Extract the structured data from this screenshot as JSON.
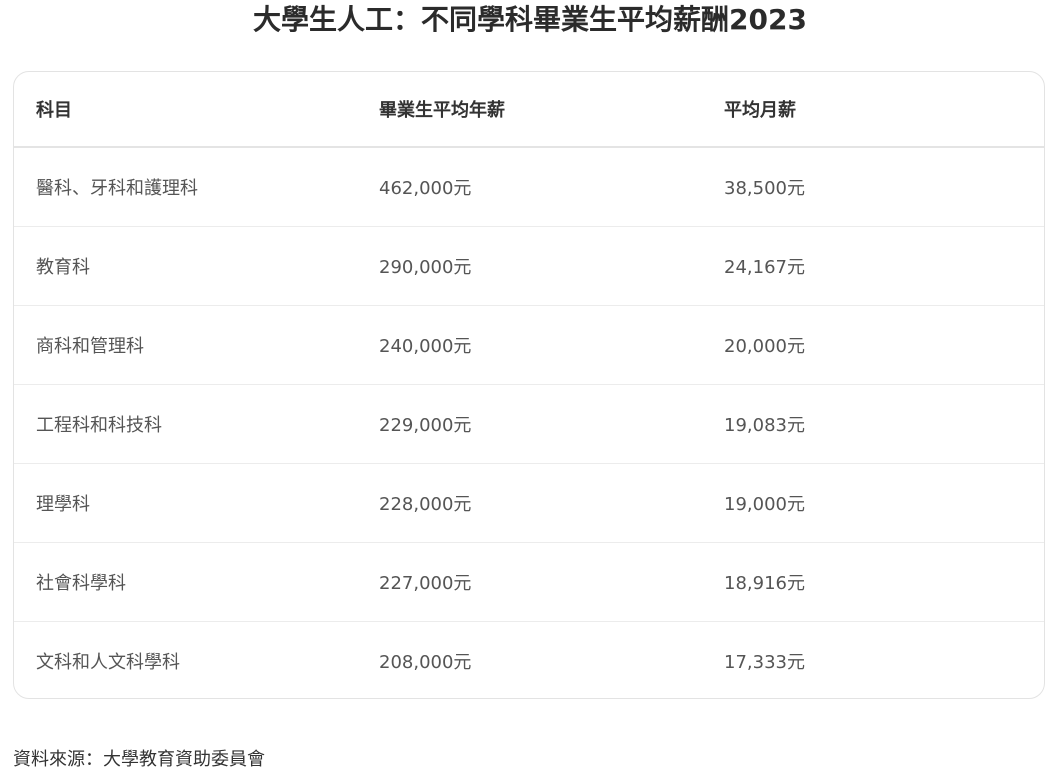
{
  "title": "大學生人工：不同學科畢業生平均薪酬2023",
  "table": {
    "headers": [
      "科目",
      "畢業生平均年薪",
      "平均月薪"
    ],
    "rows": [
      [
        "醫科、牙科和護理科",
        "462,000元",
        "38,500元"
      ],
      [
        "教育科",
        "290,000元",
        "24,167元"
      ],
      [
        "商科和管理科",
        "240,000元",
        "20,000元"
      ],
      [
        "工程科和科技科",
        "229,000元",
        "19,083元"
      ],
      [
        "理學科",
        "228,000元",
        "19,000元"
      ],
      [
        "社會科學科",
        "227,000元",
        "18,916元"
      ],
      [
        "文科和人文科學科",
        "208,000元",
        "17,333元"
      ]
    ]
  },
  "source": "資料來源：大學教育資助委員會"
}
